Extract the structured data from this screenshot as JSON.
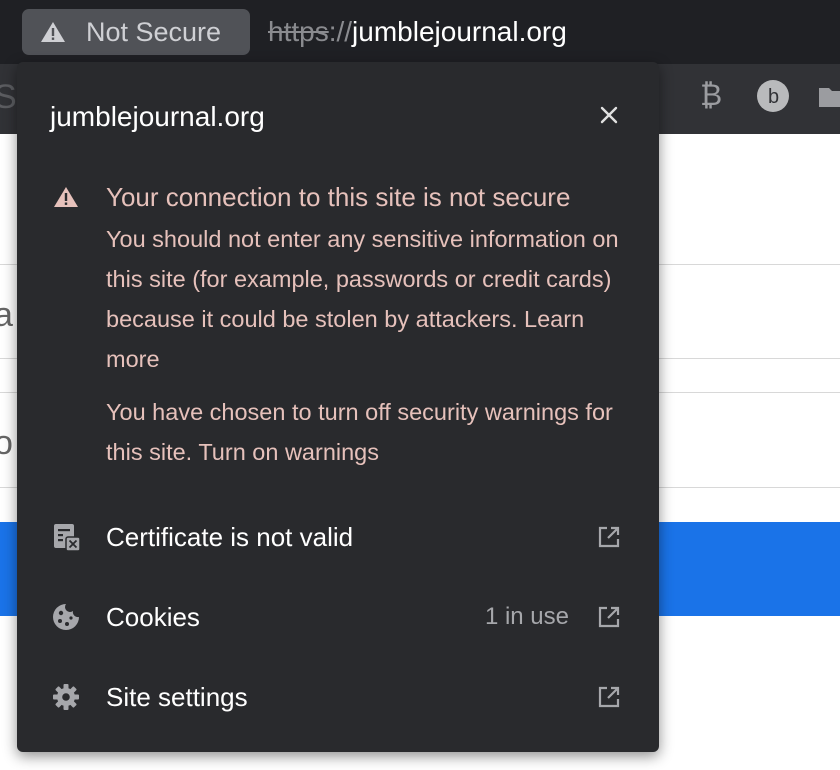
{
  "address_bar": {
    "security_chip": {
      "icon": "warning-triangle-icon",
      "label": "Not Secure"
    },
    "url": {
      "scheme": "https",
      "separator": "://",
      "host": "jumblejournal.org"
    }
  },
  "toolbar": {
    "icons": [
      "extensions-icon",
      "grammarly-icon",
      "bitly-icon",
      "folder-icon"
    ]
  },
  "popup": {
    "title": "jumblejournal.org",
    "close_icon": "close-icon",
    "warning": {
      "icon": "warning-triangle-icon",
      "heading": "Your connection to this site is not secure",
      "body": "You should not enter any sensitive information on this site (for example, passwords or credit cards) because it could be stolen by attackers.",
      "learn_more": "Learn more",
      "warnings_off_text": "You have chosen to turn off security warnings for this site.",
      "turn_on_warnings": "Turn on warnings"
    },
    "items": [
      {
        "icon": "certificate-icon",
        "label": "Certificate is not valid",
        "meta": "",
        "action_icon": "external-link-icon"
      },
      {
        "icon": "cookie-icon",
        "label": "Cookies",
        "meta": "1 in use",
        "action_icon": "external-link-icon"
      },
      {
        "icon": "gear-icon",
        "label": "Site settings",
        "meta": "",
        "action_icon": "external-link-icon"
      }
    ]
  },
  "colors": {
    "popup_bg": "#292a2d",
    "warning_text": "#e6c1bb",
    "chip_bg": "#505257",
    "page_highlight": "#1a73e8"
  }
}
